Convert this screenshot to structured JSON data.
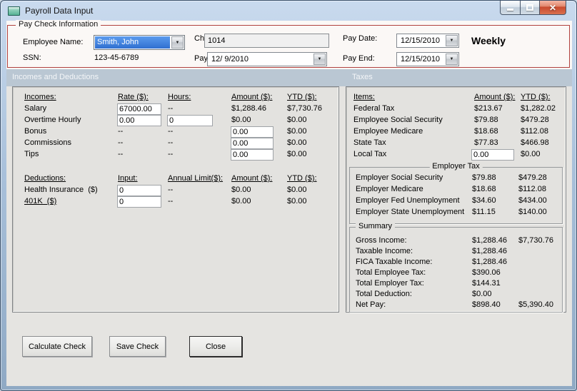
{
  "window": {
    "title": "Payroll Data Input"
  },
  "icons": {
    "close": "✕",
    "dropdown": "▼"
  },
  "paycheck_info": {
    "title": "Pay Check Information",
    "employee_name_label": "Employee Name:",
    "employee_name_value": "Smith, John",
    "ssn_label": "SSN:",
    "ssn_value": "123-45-6789",
    "check_number_label": "Check Number:",
    "check_number_value": "1014",
    "pay_start_label": "Pay Start:",
    "pay_start_value": "12/ 9/2010",
    "pay_date_label": "Pay Date:",
    "pay_date_value": "12/15/2010",
    "pay_end_label": "Pay End:",
    "pay_end_value": "12/15/2010",
    "frequency": "Weekly"
  },
  "sections": {
    "incomes_and_deductions": "Incomes and Deductions",
    "taxes": "Taxes"
  },
  "incomes": {
    "headers": [
      "Incomes:",
      "Rate ($):",
      "Hours:",
      "Amount ($):",
      "YTD ($):"
    ],
    "rows": [
      {
        "label": "Salary",
        "rate": "67000.00",
        "hours": "--",
        "amount": "$1,288.46",
        "ytd": "$7,730.76"
      },
      {
        "label": "Overtime Hourly",
        "rate": "0.00",
        "hours": "0",
        "amount": "$0.00",
        "ytd": "$0.00"
      },
      {
        "label": "Bonus",
        "rate": "--",
        "hours": "--",
        "amount": "0.00",
        "ytd": "$0.00"
      },
      {
        "label": "Commissions",
        "rate": "--",
        "hours": "--",
        "amount": "0.00",
        "ytd": "$0.00"
      },
      {
        "label": "Tips",
        "rate": "--",
        "hours": "--",
        "amount": "0.00",
        "ytd": "$0.00"
      }
    ]
  },
  "deductions": {
    "headers": [
      "Deductions:",
      "Input:",
      "Annual Limit($):",
      "Amount ($):",
      "YTD ($):"
    ],
    "rows": [
      {
        "label": "Health Insurance  ($)",
        "input": "0",
        "limit": "--",
        "amount": "$0.00",
        "ytd": "$0.00"
      },
      {
        "label": "401K  ($)",
        "input": "0",
        "limit": "--",
        "amount": "$0.00",
        "ytd": "$0.00"
      }
    ]
  },
  "taxes": {
    "headers": [
      "Items:",
      "Amount ($):",
      "YTD ($):"
    ],
    "rows": [
      {
        "label": "Federal Tax",
        "amount": "$213.67",
        "ytd": "$1,282.02"
      },
      {
        "label": "Employee Social Security",
        "amount": "$79.88",
        "ytd": "$479.28"
      },
      {
        "label": "Employee Medicare",
        "amount": "$18.68",
        "ytd": "$112.08"
      },
      {
        "label": "State Tax",
        "amount": "$77.83",
        "ytd": "$466.98"
      },
      {
        "label": "Local Tax",
        "amount": "0.00",
        "ytd": "$0.00"
      }
    ],
    "employer_group": {
      "title": "Employer Tax",
      "rows": [
        {
          "label": "Employer Social Security",
          "amount": "$79.88",
          "ytd": "$479.28"
        },
        {
          "label": "Employer Medicare",
          "amount": "$18.68",
          "ytd": "$112.08"
        },
        {
          "label": "Employer Fed Unemployment",
          "amount": "$34.60",
          "ytd": "$434.00"
        },
        {
          "label": "Employer State Unemployment",
          "amount": "$11.15",
          "ytd": "$140.00"
        }
      ]
    }
  },
  "summary": {
    "title": "Summary",
    "rows": [
      {
        "label": "Gross Income:",
        "amount": "$1,288.46",
        "ytd": "$7,730.76"
      },
      {
        "label": "Taxable Income:",
        "amount": "$1,288.46",
        "ytd": ""
      },
      {
        "label": "FICA Taxable Income:",
        "amount": "$1,288.46",
        "ytd": ""
      },
      {
        "label": "Total Employee Tax:",
        "amount": "$390.06",
        "ytd": ""
      },
      {
        "label": "Total Employer Tax:",
        "amount": "$144.31",
        "ytd": ""
      },
      {
        "label": "Total Deduction:",
        "amount": "$0.00",
        "ytd": ""
      },
      {
        "label": "Net Pay:",
        "amount": "$898.40",
        "ytd": "$5,390.40"
      }
    ]
  },
  "buttons": {
    "calculate": "Calculate Check",
    "save": "Save Check",
    "close": "Close"
  },
  "colors": {
    "paycheck_border": "#b0413e",
    "section_header_bg": "#bac7d3",
    "selection_blue": "#3675d9",
    "close_button_red": "#c94a2f",
    "client_bg": "#e5e4e1"
  }
}
